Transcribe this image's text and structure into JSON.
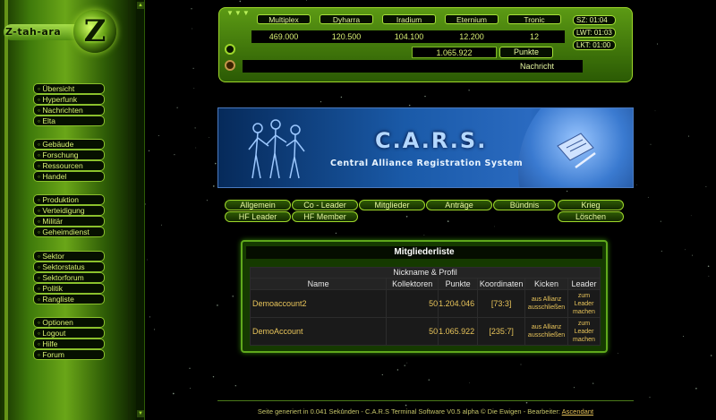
{
  "app": {
    "logo_text": "Z-tah-ara",
    "logo_letter": "Z"
  },
  "sidebar": {
    "groups": [
      [
        "Übersicht",
        "Hyperfunk",
        "Nachrichten",
        "Elta"
      ],
      [
        "Gebäude",
        "Forschung",
        "Ressourcen",
        "Handel"
      ],
      [
        "Produktion",
        "Verteidigung",
        "Militär",
        "Geheimdienst"
      ],
      [
        "Sektor",
        "Sektorstatus",
        "Sektorforum",
        "Politik",
        "Rangliste"
      ],
      [
        "Optionen",
        "Logout",
        "Hilfe",
        "Forum"
      ]
    ]
  },
  "resources": [
    {
      "name": "Multiplex",
      "value": "469.000"
    },
    {
      "name": "Dyharra",
      "value": "120.500"
    },
    {
      "name": "Iradium",
      "value": "104.100"
    },
    {
      "name": "Eternium",
      "value": "12.200"
    },
    {
      "name": "Tronic",
      "value": "12"
    }
  ],
  "ticks": [
    {
      "label": "SZ: 01:04"
    },
    {
      "label": "LWT: 01:03"
    },
    {
      "label": "LKT: 01:00"
    }
  ],
  "points": {
    "value": "1.065.922",
    "label": "Punkte"
  },
  "message_label": "Nachricht",
  "banner": {
    "title": "C.A.R.S.",
    "subtitle": "Central Alliance Registration System"
  },
  "tabs": {
    "row1": [
      "Allgemein",
      "Co - Leader",
      "Mitglieder",
      "Anträge",
      "Bündnis",
      "Krieg"
    ],
    "row2": [
      "HF Leader",
      "HF Member",
      "Löschen"
    ]
  },
  "members": {
    "title": "Mitgliederliste",
    "group_header": "Nickname & Profil",
    "columns": [
      "Name",
      "Kollektoren",
      "Punkte",
      "Koordinaten",
      "Kicken",
      "Leader"
    ],
    "rows": [
      {
        "name": "Demoaccount2",
        "kollektoren": "50",
        "punkte": "1.204.046",
        "koordinaten": "[73:3]",
        "kicken": "aus Allianz ausschließen",
        "leader": "zum Leader machen"
      },
      {
        "name": "DemoAccount",
        "kollektoren": "50",
        "punkte": "1.065.922",
        "koordinaten": "[235:7]",
        "kicken": "aus Allianz ausschließen",
        "leader": "zum Leader machen"
      }
    ]
  },
  "footer": {
    "text": "Seite generiert in 0.041 Sekunden - C.A.R.S Terminal Software V0.5 alpha © Die Ewigen - Bearbeiter: ",
    "link": "Ascendant"
  }
}
